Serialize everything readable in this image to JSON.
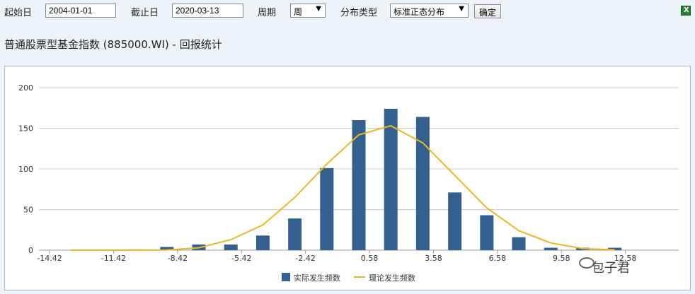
{
  "toolbar": {
    "start_label": "起始日",
    "start_value": "2004-01-01",
    "end_label": "截止日",
    "end_value": "2020-03-13",
    "period_label": "周期",
    "period_value": "周",
    "dist_label": "分布类型",
    "dist_value": "标准正态分布",
    "confirm_label": "确定",
    "export_icon": "excel-export-icon"
  },
  "title": "普通股票型基金指数 (885000.WI) - 回报统计",
  "watermark": "包子君",
  "colors": {
    "bar": "#34608f",
    "line": "#e8b923",
    "grid": "#cccccc"
  },
  "chart_data": {
    "type": "bar",
    "x_ticks": [
      "-14.42",
      "-11.42",
      "-8.42",
      "-5.42",
      "-2.42",
      "0.58",
      "3.58",
      "6.58",
      "9.58",
      "12.58"
    ],
    "y_ticks": [
      "0",
      "50",
      "100",
      "150",
      "200"
    ],
    "ylim": [
      0,
      200
    ],
    "xlim": [
      -14.92,
      15.08
    ],
    "bin_centers": [
      -13.42,
      -11.92,
      -10.42,
      -8.92,
      -7.42,
      -5.92,
      -4.42,
      -2.92,
      -1.42,
      0.08,
      1.58,
      3.08,
      4.58,
      6.08,
      7.58,
      9.08,
      10.58,
      12.08
    ],
    "series": [
      {
        "name": "实际发生频数",
        "type": "bar",
        "values": [
          0,
          0,
          1,
          4,
          7,
          7,
          18,
          39,
          101,
          160,
          174,
          164,
          71,
          43,
          16,
          3,
          3,
          3
        ]
      },
      {
        "name": "理论发生频数",
        "type": "line",
        "values": [
          0,
          0,
          0,
          0.3,
          3,
          13,
          31,
          65,
          106,
          142,
          153,
          132,
          92,
          52,
          24,
          9,
          2,
          0.5
        ]
      }
    ],
    "legend_position": "bottom-center",
    "grid": true
  }
}
